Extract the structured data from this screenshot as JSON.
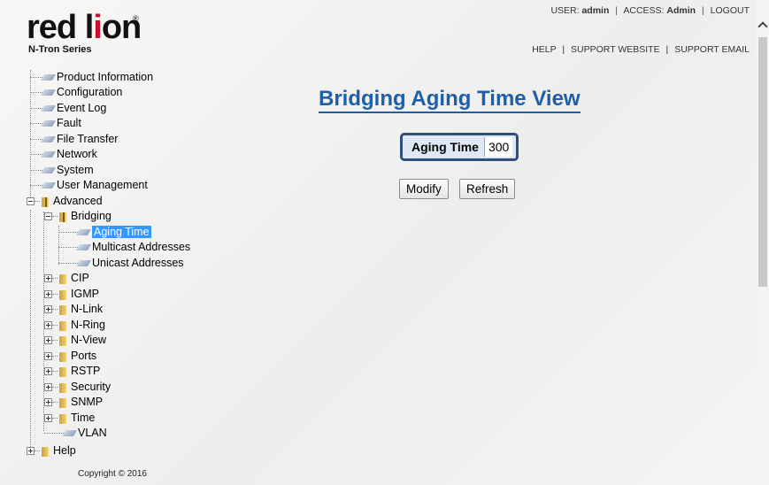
{
  "header": {
    "logo_text_a": "red l",
    "logo_text_b": "i",
    "logo_text_c": "on",
    "logo_reg": "®",
    "logo_sub": "N-Tron Series",
    "user_label": "USER:",
    "user_value": "admin",
    "access_label": "ACCESS:",
    "access_value": "Admin",
    "logout": "LOGOUT",
    "help": "HELP",
    "support_website": "SUPPORT WEBSITE",
    "support_email": "SUPPORT EMAIL"
  },
  "tree": {
    "product_information": "Product Information",
    "configuration": "Configuration",
    "event_log": "Event Log",
    "fault": "Fault",
    "file_transfer": "File Transfer",
    "network": "Network",
    "system": "System",
    "user_management": "User Management",
    "advanced": "Advanced",
    "bridging": "Bridging",
    "aging_time": "Aging Time",
    "multicast_addresses": "Multicast Addresses",
    "unicast_addresses": "Unicast Addresses",
    "cip": "CIP",
    "igmp": "IGMP",
    "n_link": "N-Link",
    "n_ring": "N-Ring",
    "n_view": "N-View",
    "ports": "Ports",
    "rstp": "RSTP",
    "security": "Security",
    "snmp": "SNMP",
    "time": "Time",
    "vlan": "VLAN",
    "help": "Help"
  },
  "footer": {
    "copyright": "Copyright © 2016"
  },
  "main": {
    "title": "Bridging Aging Time View",
    "aging_label": "Aging Time",
    "aging_value": "300",
    "modify_label": "Modify",
    "refresh_label": "Refresh"
  }
}
